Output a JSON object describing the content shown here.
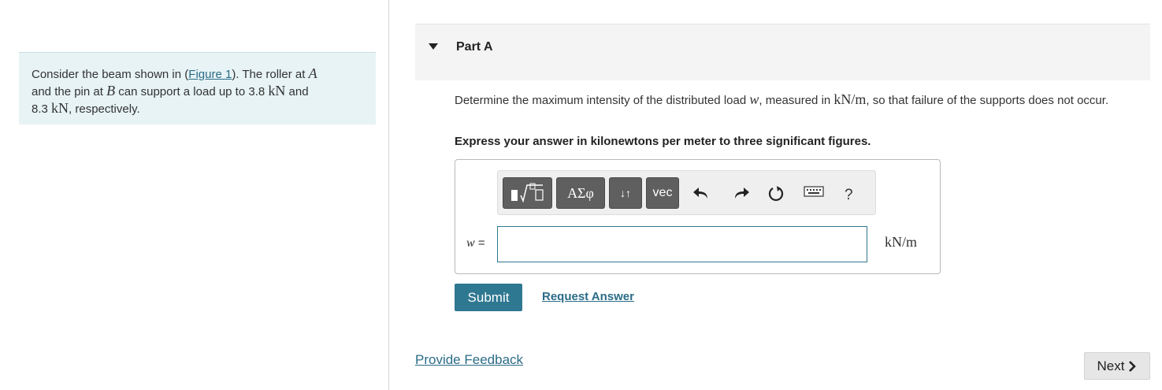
{
  "intro": {
    "t1": "Consider the beam shown in (",
    "figure_link": "Figure 1",
    "t2": "). The roller at ",
    "point_a": "A",
    "t3": " and the pin at ",
    "point_b": "B",
    "t4": " can support a load up to 3.8 ",
    "unit1": "kN",
    "t5": " and 8.3 ",
    "unit2": "kN",
    "t6": ", respectively."
  },
  "part": {
    "title": "Part A",
    "question": {
      "t1": "Determine the maximum intensity of the distributed load ",
      "var": "w",
      "t2": ", measured in ",
      "unit": "kN/m",
      "t3": ", so that failure of the supports does not occur."
    },
    "instruction": "Express your answer in kilonewtons per meter to three significant figures."
  },
  "toolbar": {
    "templates_icon": "templates-icon",
    "greek_label": "ΑΣφ",
    "arrows_label": "↓↑",
    "vec_label": "vec",
    "undo_icon": "undo-icon",
    "redo_icon": "redo-icon",
    "reset_icon": "reset-icon",
    "keyboard_icon": "keyboard-icon",
    "help_label": "?"
  },
  "answer": {
    "variable_label": "w =",
    "value": "",
    "unit": "kN/m"
  },
  "actions": {
    "submit": "Submit",
    "request_answer": "Request Answer",
    "provide_feedback": "Provide Feedback",
    "next": "Next"
  },
  "colors": {
    "accent": "#2f7891",
    "link": "#2b6c88",
    "intro_bg": "#e7f3f5",
    "button_dark": "#5f5f5f"
  }
}
